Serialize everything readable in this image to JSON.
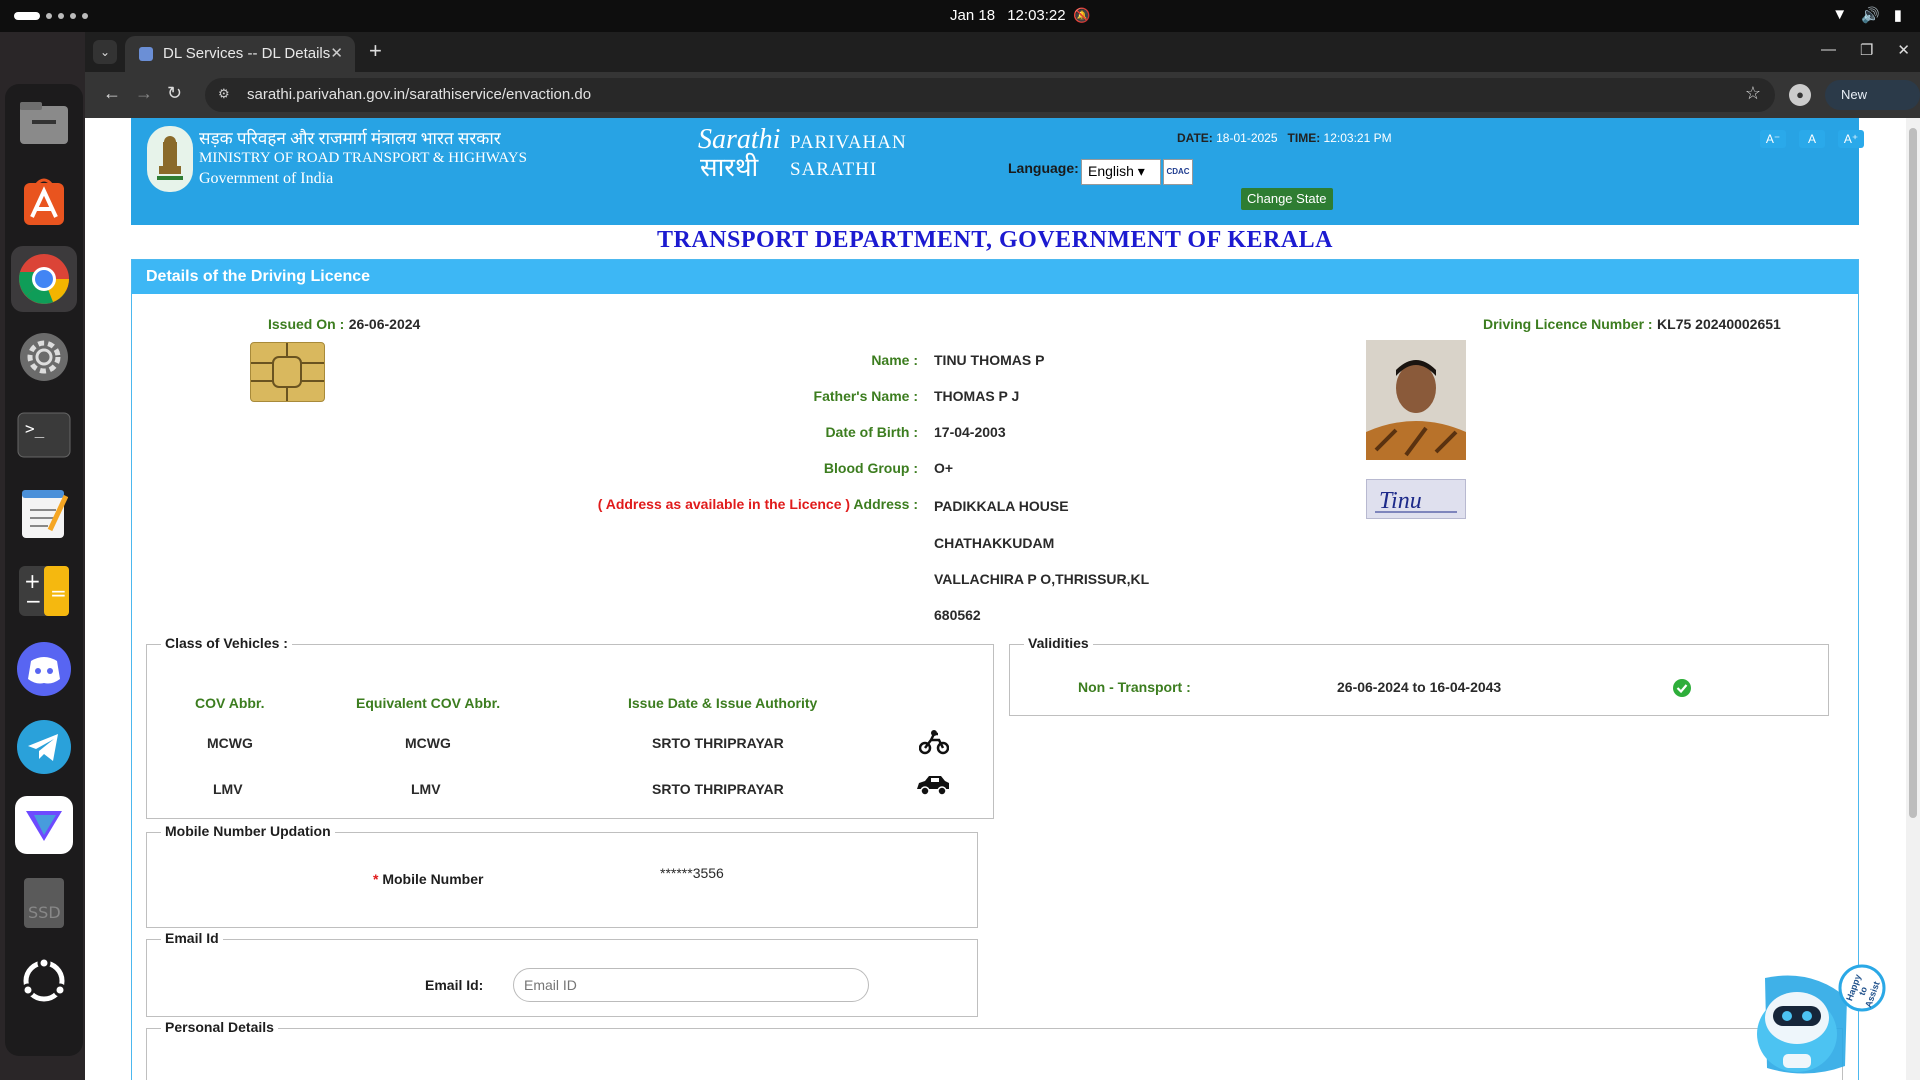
{
  "system": {
    "date": "Jan 18",
    "time": "12:03:22"
  },
  "browser": {
    "tab_title": "DL Services -- DL Details",
    "url": "sarathi.parivahan.gov.in/sarathiservice/envaction.do",
    "new_chrome": "New Chrome available"
  },
  "header": {
    "hindi_line": "सड़क परिवहन और राजमार्ग मंत्रालय भारत सरकार",
    "ministry": "MINISTRY OF ROAD TRANSPORT & HIGHWAYS",
    "govt": "Government of India",
    "parivahan": "PARIVAHAN",
    "sarathi": "SARATHI",
    "date_label": "DATE:",
    "date_value": "18-01-2025",
    "time_label": "TIME:",
    "time_value": "12:03:21 PM",
    "language_label": "Language:",
    "language_value": "English",
    "change_state": "Change State",
    "font_small": "A⁻",
    "font_normal": "A",
    "font_large": "A⁺"
  },
  "department": "TRANSPORT DEPARTMENT, GOVERNMENT OF KERALA",
  "panel_title": "Details of the Driving Licence",
  "licence": {
    "issued_on_label": "Issued On :",
    "issued_on": "26-06-2024",
    "dl_number_label": "Driving Licence Number :",
    "dl_number": "KL75 20240002651",
    "name_label": "Name :",
    "name": "TINU THOMAS P",
    "father_label": "Father's Name :",
    "father": "THOMAS P J",
    "dob_label": "Date of Birth :",
    "dob": "17-04-2003",
    "blood_label": "Blood Group :",
    "blood": "O+",
    "address_note": "( Address as available in the Licence )",
    "address_label": "Address :",
    "address_lines": [
      "PADIKKALA HOUSE",
      "CHATHAKKUDAM",
      "VALLACHIRA P O,THRISSUR,KL",
      "680562"
    ],
    "signature": "Tinu"
  },
  "cov": {
    "legend": "Class of Vehicles :",
    "headers": [
      "COV Abbr.",
      "Equivalent COV Abbr.",
      "Issue Date & Issue Authority"
    ],
    "rows": [
      {
        "abbr": "MCWG",
        "equiv": "MCWG",
        "authority": "SRTO THRIPRAYAR",
        "icon": "motorcycle-icon"
      },
      {
        "abbr": "LMV",
        "equiv": "LMV",
        "authority": "SRTO THRIPRAYAR",
        "icon": "car-icon"
      }
    ]
  },
  "validities": {
    "legend": "Validities",
    "label": "Non - Transport :",
    "range": "26-06-2024 to 16-04-2043"
  },
  "mobile": {
    "legend": "Mobile Number Updation",
    "required": "*",
    "label": "Mobile Number",
    "value": "******3556"
  },
  "email": {
    "legend": "Email Id",
    "label": "Email Id:",
    "placeholder": "Email ID"
  },
  "personal": {
    "legend": "Personal Details"
  },
  "assistant": {
    "badge": "Happy to Assist"
  },
  "colors": {
    "banner": "#28a3e4",
    "panel_head": "#3db7f5",
    "label_green": "#3c7d1f",
    "dept_blue": "#1c1ad0"
  }
}
